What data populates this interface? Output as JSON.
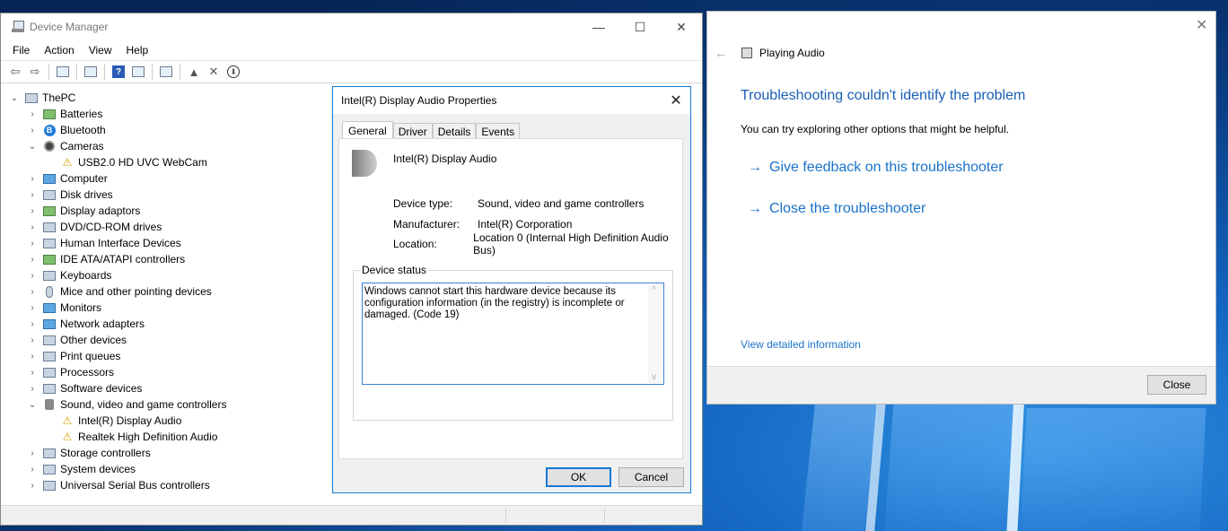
{
  "device_manager": {
    "title": "Device Manager",
    "menu": [
      "File",
      "Action",
      "View",
      "Help"
    ],
    "tree": [
      {
        "label": "ThePC",
        "expanded": true,
        "level": 0
      },
      {
        "label": "Batteries",
        "level": 1
      },
      {
        "label": "Bluetooth",
        "level": 1
      },
      {
        "label": "Cameras",
        "expanded": true,
        "level": 1
      },
      {
        "label": "USB2.0 HD UVC WebCam",
        "level": 2,
        "warning": true
      },
      {
        "label": "Computer",
        "level": 1
      },
      {
        "label": "Disk drives",
        "level": 1
      },
      {
        "label": "Display adaptors",
        "level": 1
      },
      {
        "label": "DVD/CD-ROM drives",
        "level": 1
      },
      {
        "label": "Human Interface Devices",
        "level": 1
      },
      {
        "label": "IDE ATA/ATAPI controllers",
        "level": 1
      },
      {
        "label": "Keyboards",
        "level": 1
      },
      {
        "label": "Mice and other pointing devices",
        "level": 1
      },
      {
        "label": "Monitors",
        "level": 1
      },
      {
        "label": "Network adapters",
        "level": 1
      },
      {
        "label": "Other devices",
        "level": 1
      },
      {
        "label": "Print queues",
        "level": 1
      },
      {
        "label": "Processors",
        "level": 1
      },
      {
        "label": "Software devices",
        "level": 1
      },
      {
        "label": "Sound, video and game controllers",
        "expanded": true,
        "level": 1
      },
      {
        "label": "Intel(R) Display Audio",
        "level": 2,
        "warning": true
      },
      {
        "label": "Realtek High Definition Audio",
        "level": 2,
        "warning": true
      },
      {
        "label": "Storage controllers",
        "level": 1
      },
      {
        "label": "System devices",
        "level": 1
      },
      {
        "label": "Universal Serial Bus controllers",
        "level": 1
      }
    ]
  },
  "properties": {
    "title": "Intel(R) Display Audio Properties",
    "tabs": [
      "General",
      "Driver",
      "Details",
      "Events"
    ],
    "device_name": "Intel(R) Display Audio",
    "rows": [
      {
        "key": "Device type:",
        "value": "Sound, video and game controllers"
      },
      {
        "key": "Manufacturer:",
        "value": "Intel(R) Corporation"
      },
      {
        "key": "Location:",
        "value": "Location 0 (Internal High Definition Audio Bus)"
      }
    ],
    "status_legend": "Device status",
    "status_text": "Windows cannot start this hardware device because its configuration information (in the registry) is incomplete or damaged. (Code 19)",
    "ok_label": "OK",
    "cancel_label": "Cancel"
  },
  "troubleshooter": {
    "header": "Playing Audio",
    "heading": "Troubleshooting couldn't identify the problem",
    "subtext": "You can try exploring other options that might be helpful.",
    "link_feedback": "Give feedback on this troubleshooter",
    "link_close": "Close the troubleshooter",
    "detail_link": "View detailed information",
    "close_label": "Close"
  }
}
